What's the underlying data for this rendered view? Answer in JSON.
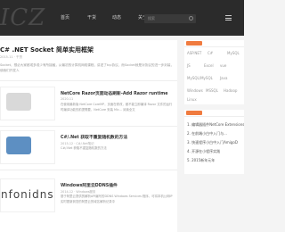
{
  "header": {
    "logo": "ICZ",
    "nav": [
      "首页",
      "干货",
      "动态",
      "关于"
    ],
    "search_placeholder": "搜索"
  },
  "featured": {
    "title": "C# .NET Socket 简单实用框架",
    "meta": "2015-11 · 干货",
    "excerpt": "Socket，想必大家都或多或少有所接触，从最初的计算机网络课程，讲述了tcp协议，而Socket就是对协议的进一步封装，使我们开发人"
  },
  "posts": [
    {
      "thumb_text": "",
      "title": "NetCore Razor页面动态刷新-Add Razor runtime",
      "meta": "2020-11",
      "excerpt": "在使用最新版 NetCore CoreMP，页面在修改，都不能立即编译 Razor 文件的运行时编译功能的前提需要，NetCore 安装 Mic... 阅读全文"
    },
    {
      "thumb_text": "",
      "title": "C#/.Net 获取不重复随机数的方法",
      "meta": "2015-12 · C#/.Net笔记",
      "excerpt": "C#/.Net 获取不重复随机数的方法"
    },
    {
      "thumb_text": "nfonidns",
      "title": "Windows阿里云DDNS插件",
      "meta": "2014-12 · Windows服务",
      "excerpt": "基于阿里云提供的解析API编写的DDNS Windows Services 程序，可将本机公网IP实时更新到您的阿里云的域名解析记录中"
    }
  ],
  "sidebar": {
    "tags": [
      "ASP.NET",
      "C#",
      "MySQL",
      "JS",
      "Excel",
      "vue",
      "MySQL/MySQL",
      "Java",
      "Windows",
      "MSSQL",
      "Hadoop",
      "Linux"
    ],
    "recent": [
      "1. 编辑器插件NetCore Extensions",
      "2. 在前端小白中入门与...",
      "3. 快速程序小白中入门AmigoD",
      "4. 开源在小程序实践",
      "5. 2015新年元年"
    ]
  }
}
